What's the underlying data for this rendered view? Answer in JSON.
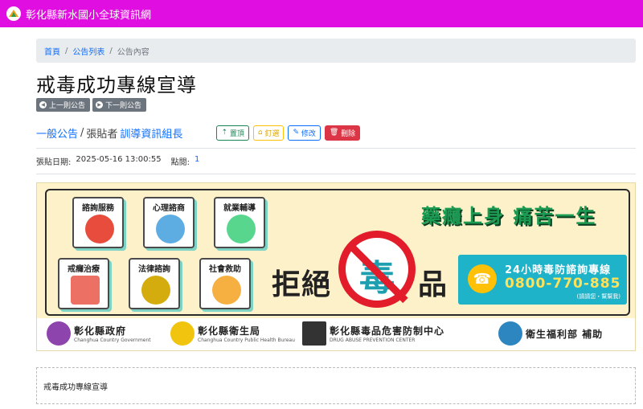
{
  "header": {
    "site_title": "彰化縣新水國小全球資訊網",
    "bg_color": "#e10ee1"
  },
  "breadcrumb": {
    "home": "首頁",
    "list": "公告列表",
    "current": "公告內容"
  },
  "page_title": "戒毒成功專線宣導",
  "nav": {
    "prev": "上一則公告",
    "next": "下一則公告"
  },
  "meta": {
    "category": "一般公告",
    "poster_label": "張貼者",
    "poster_name": "訓導資訊組長"
  },
  "actions": {
    "top": "置頂",
    "pin": "釘選",
    "edit": "修改",
    "delete": "刪除"
  },
  "info": {
    "date_label": "張貼日期:",
    "date_value": "2025-05-16 13:00:55",
    "hits_label": "點閱:",
    "hits_value": "1"
  },
  "banner": {
    "services": [
      "諮詢服務",
      "心理諮商",
      "就業輔導",
      "戒癮治療",
      "法律諮詢",
      "社會救助"
    ],
    "slogan": "藥癮上身 痛苦一生",
    "refuse": "拒絕",
    "poison": "毒",
    "product": "品",
    "hotline_title": "24小時毒防諮詢專線",
    "hotline_number": "0800-770-885",
    "hotline_note": "(請請您・幫幫我)",
    "logos": [
      {
        "name": "彰化縣政府",
        "sub": "Changhua Country Government"
      },
      {
        "name": "彰化縣衛生局",
        "sub": "Changhua Country Public Health Bureau"
      },
      {
        "name": "彰化縣毒品危害防制中心",
        "sub": "DRUG ABUSE PREVENTION CENTER"
      },
      {
        "name": "衛生福利部 補助",
        "sub": ""
      }
    ]
  },
  "content": {
    "body": "戒毒成功專線宣導"
  }
}
